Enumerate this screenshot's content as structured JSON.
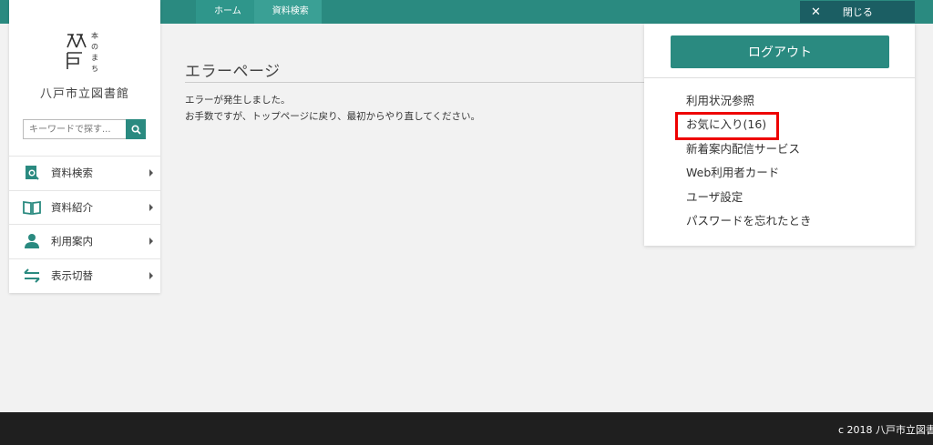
{
  "breadcrumb": {
    "items": [
      "ホーム",
      "資料検索"
    ]
  },
  "header": {
    "close_label": "閉じる",
    "close_icon": "close-icon"
  },
  "sidebar": {
    "logo_text": "本のまち",
    "library_name": "八戸市立図書館",
    "search_placeholder": "キーワードで探す...",
    "nav": [
      {
        "label": "資料検索",
        "icon": "search-document-icon"
      },
      {
        "label": "資料紹介",
        "icon": "open-book-icon"
      },
      {
        "label": "利用案内",
        "icon": "person-icon"
      },
      {
        "label": "表示切替",
        "icon": "switch-arrows-icon"
      }
    ]
  },
  "main": {
    "title": "エラーページ",
    "message_line1": "エラーが発生しました。",
    "message_line2": "お手数ですが、トップページに戻り、最初からやり直してください。"
  },
  "account_menu": {
    "logout_label": "ログアウト",
    "items": [
      "利用状況参照",
      "お気に入り(16)",
      "新着案内配信サービス",
      "Web利用者カード",
      "ユーザ設定",
      "パスワードを忘れたとき"
    ]
  },
  "footer": {
    "copyright": "c 2018 八戸市立図書"
  },
  "colors": {
    "brand_teal": "#2a8a80",
    "close_button": "#1b5e63",
    "highlight_red": "#e00000",
    "footer": "#1f1f1f"
  }
}
